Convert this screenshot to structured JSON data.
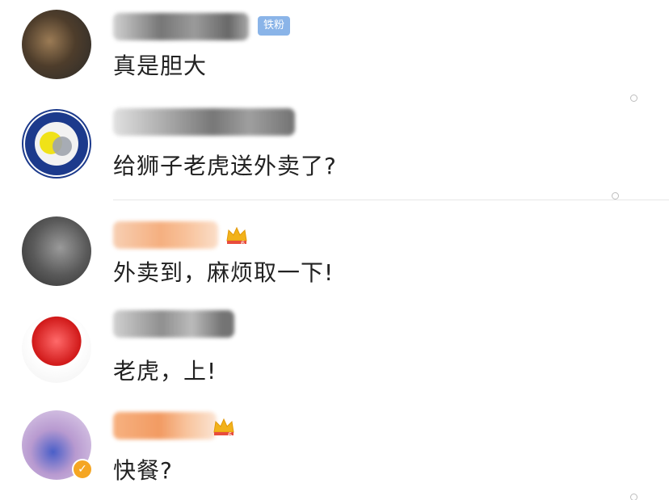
{
  "comments": [
    {
      "username_hidden": true,
      "badge": "铁粉",
      "text": "真是胆大",
      "avatar_icon": "avatar-photo-dark",
      "avatar_color": "#5a4a3a"
    },
    {
      "username_hidden": true,
      "text": "给狮子老虎送外卖了?",
      "avatar_icon": "avatar-mentholatum-logo",
      "avatar_color": "#1c3a8c"
    },
    {
      "username_hidden": true,
      "crown_level": "6",
      "text": "外卖到，麻烦取一下!",
      "avatar_icon": "avatar-photo-gray",
      "avatar_color": "#6b6b6b"
    },
    {
      "username_hidden": true,
      "text": "老虎，上!",
      "avatar_icon": "avatar-photo-red",
      "avatar_color": "#d01818"
    },
    {
      "username_hidden": true,
      "crown_level": "6",
      "text": "快餐?",
      "avatar_icon": "avatar-photo-purple",
      "avatar_color": "#b89ad0",
      "verified": true
    }
  ],
  "colors": {
    "fan_badge": "#8ab4e8",
    "crown_gold": "#f2b21b",
    "username_orange": "#f4a26a",
    "username_gray": "#9a9a9a"
  }
}
